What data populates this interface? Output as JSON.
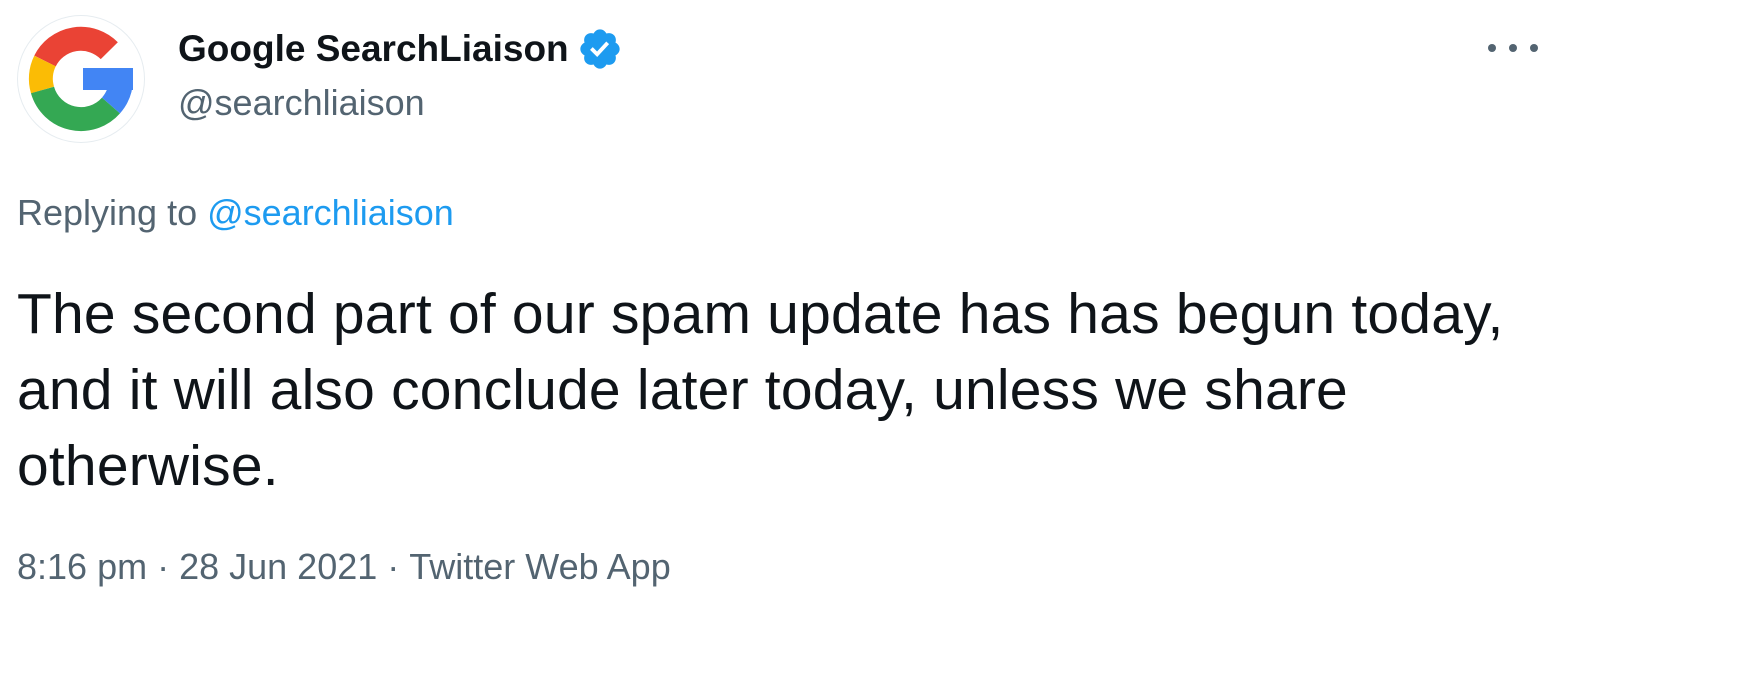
{
  "author": {
    "display_name": "Google SearchLiaison",
    "handle": "@searchliaison",
    "verified": true,
    "avatar_icon": "google-g-logo-icon",
    "verified_icon": "verified-badge-icon"
  },
  "more_icon": "more-options-icon",
  "reply": {
    "prefix": "Replying to",
    "target": "@searchliaison"
  },
  "tweet": {
    "text": "The second part of our spam update has has begun today, and it will also conclude later today, unless we share otherwise."
  },
  "meta": {
    "time": "8:16 pm",
    "separator": "·",
    "date": "28 Jun 2021",
    "source": "Twitter Web App"
  },
  "colors": {
    "text_primary": "#0f1419",
    "text_secondary": "#536471",
    "link": "#1d9bf0",
    "verified": "#1d9bf0",
    "google_red": "#ea4335",
    "google_yellow": "#fbbc05",
    "google_green": "#34a853",
    "google_blue": "#4285f4"
  }
}
